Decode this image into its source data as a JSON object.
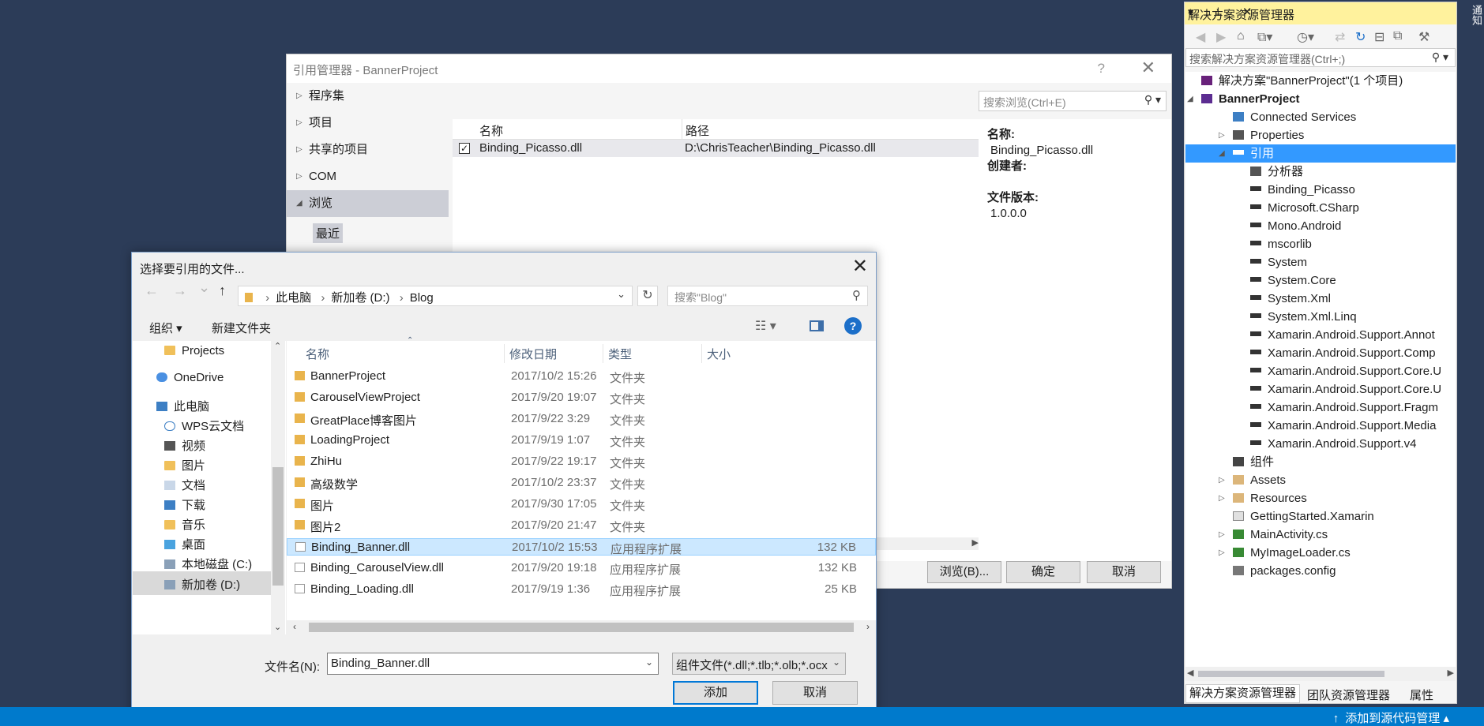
{
  "ref_manager": {
    "title": "引用管理器 - BannerProject",
    "help": "?",
    "close": "✕",
    "nav": [
      {
        "label": "程序集",
        "arrow": "▷"
      },
      {
        "label": "项目",
        "arrow": "▷"
      },
      {
        "label": "共享的项目",
        "arrow": "▷"
      },
      {
        "label": "COM",
        "arrow": "▷"
      },
      {
        "label": "浏览",
        "arrow": "◢"
      }
    ],
    "nav_sub": "最近",
    "search_placeholder": "搜索浏览(Ctrl+E)",
    "columns": {
      "name": "名称",
      "path": "路径"
    },
    "rows": [
      {
        "checked": "✓",
        "name": "Binding_Picasso.dll",
        "path": "D:\\ChrisTeacher\\Binding_Picasso.dll"
      }
    ],
    "details": {
      "name_label": "名称:",
      "name_value": "Binding_Picasso.dll",
      "creator_label": "创建者:",
      "version_label": "文件版本:",
      "version_value": "1.0.0.0"
    },
    "buttons": {
      "browse": "浏览(B)...",
      "ok": "确定",
      "cancel": "取消"
    }
  },
  "file_dialog": {
    "title": "选择要引用的文件...",
    "close": "✕",
    "nav": {
      "back": "←",
      "forward": "→",
      "down": "⌄",
      "up": "↑"
    },
    "breadcrumb": [
      "此电脑",
      "新加卷 (D:)",
      "Blog"
    ],
    "search_placeholder": "搜索\"Blog\"",
    "toolbar": {
      "organize": "组织 ▾",
      "new_folder": "新建文件夹"
    },
    "tree": [
      {
        "label": "Projects",
        "icon": "folder-icon"
      },
      {
        "label": "OneDrive",
        "icon": "cloud-icon"
      },
      {
        "label": "此电脑",
        "icon": "pc-icon"
      },
      {
        "label": "WPS云文档",
        "icon": "cloud-icon"
      },
      {
        "label": "视频",
        "icon": "video-icon"
      },
      {
        "label": "图片",
        "icon": "pictures-icon"
      },
      {
        "label": "文档",
        "icon": "documents-icon"
      },
      {
        "label": "下载",
        "icon": "download-icon"
      },
      {
        "label": "音乐",
        "icon": "music-icon"
      },
      {
        "label": "桌面",
        "icon": "desktop-icon"
      },
      {
        "label": "本地磁盘 (C:)",
        "icon": "drive-icon"
      },
      {
        "label": "新加卷 (D:)",
        "icon": "drive-icon"
      }
    ],
    "columns": {
      "name": "名称",
      "date": "修改日期",
      "type": "类型",
      "size": "大小"
    },
    "files": [
      {
        "name": "BannerProject",
        "date": "2017/10/2 15:26",
        "type": "文件夹",
        "size": "",
        "kind": "folder"
      },
      {
        "name": "CarouselViewProject",
        "date": "2017/9/20 19:07",
        "type": "文件夹",
        "size": "",
        "kind": "folder"
      },
      {
        "name": "GreatPlace博客图片",
        "date": "2017/9/22 3:29",
        "type": "文件夹",
        "size": "",
        "kind": "folder"
      },
      {
        "name": "LoadingProject",
        "date": "2017/9/19 1:07",
        "type": "文件夹",
        "size": "",
        "kind": "folder"
      },
      {
        "name": "ZhiHu",
        "date": "2017/9/22 19:17",
        "type": "文件夹",
        "size": "",
        "kind": "folder"
      },
      {
        "name": "高级数学",
        "date": "2017/10/2 23:37",
        "type": "文件夹",
        "size": "",
        "kind": "folder"
      },
      {
        "name": "图片",
        "date": "2017/9/30 17:05",
        "type": "文件夹",
        "size": "",
        "kind": "folder"
      },
      {
        "name": "图片2",
        "date": "2017/9/20 21:47",
        "type": "文件夹",
        "size": "",
        "kind": "folder"
      },
      {
        "name": "Binding_Banner.dll",
        "date": "2017/10/2 15:53",
        "type": "应用程序扩展",
        "size": "132 KB",
        "kind": "dll",
        "selected": true
      },
      {
        "name": "Binding_CarouselView.dll",
        "date": "2017/9/20 19:18",
        "type": "应用程序扩展",
        "size": "132 KB",
        "kind": "dll"
      },
      {
        "name": "Binding_Loading.dll",
        "date": "2017/9/19 1:36",
        "type": "应用程序扩展",
        "size": "25 KB",
        "kind": "dll"
      }
    ],
    "filename_label": "文件名(N):",
    "filename_value": "Binding_Banner.dll",
    "filetype_value": "组件文件(*.dll;*.tlb;*.olb;*.ocx",
    "buttons": {
      "add": "添加",
      "cancel": "取消"
    }
  },
  "solution_explorer": {
    "title": "解决方案资源管理器",
    "title_buttons": "▾ ⊥ ✕",
    "search_placeholder": "搜索解决方案资源管理器(Ctrl+;)",
    "tree": [
      {
        "label": "解决方案\"BannerProject\"(1 个项目)",
        "level": 0,
        "arrow": "",
        "icon": "solution-icon"
      },
      {
        "label": "BannerProject",
        "level": 0,
        "arrow": "◢",
        "icon": "project-icon",
        "bold": true
      },
      {
        "label": "Connected Services",
        "level": 1,
        "arrow": "",
        "icon": "cloud-icon"
      },
      {
        "label": "Properties",
        "level": 1,
        "arrow": "▷",
        "icon": "wrench-icon"
      },
      {
        "label": "引用",
        "level": 1,
        "arrow": "◢",
        "icon": "reference-icon",
        "selected": true
      },
      {
        "label": "分析器",
        "level": 2,
        "arrow": "",
        "icon": "analyzer-icon"
      },
      {
        "label": "Binding_Picasso",
        "level": 2,
        "arrow": "",
        "icon": "reference-icon"
      },
      {
        "label": "Microsoft.CSharp",
        "level": 2,
        "arrow": "",
        "icon": "reference-icon"
      },
      {
        "label": "Mono.Android",
        "level": 2,
        "arrow": "",
        "icon": "reference-icon"
      },
      {
        "label": "mscorlib",
        "level": 2,
        "arrow": "",
        "icon": "reference-icon"
      },
      {
        "label": "System",
        "level": 2,
        "arrow": "",
        "icon": "reference-icon"
      },
      {
        "label": "System.Core",
        "level": 2,
        "arrow": "",
        "icon": "reference-icon"
      },
      {
        "label": "System.Xml",
        "level": 2,
        "arrow": "",
        "icon": "reference-icon"
      },
      {
        "label": "System.Xml.Linq",
        "level": 2,
        "arrow": "",
        "icon": "reference-icon"
      },
      {
        "label": "Xamarin.Android.Support.Annot",
        "level": 2,
        "arrow": "",
        "icon": "reference-icon"
      },
      {
        "label": "Xamarin.Android.Support.Comp",
        "level": 2,
        "arrow": "",
        "icon": "reference-icon"
      },
      {
        "label": "Xamarin.Android.Support.Core.U",
        "level": 2,
        "arrow": "",
        "icon": "reference-icon"
      },
      {
        "label": "Xamarin.Android.Support.Core.U",
        "level": 2,
        "arrow": "",
        "icon": "reference-icon"
      },
      {
        "label": "Xamarin.Android.Support.Fragm",
        "level": 2,
        "arrow": "",
        "icon": "reference-icon"
      },
      {
        "label": "Xamarin.Android.Support.Media",
        "level": 2,
        "arrow": "",
        "icon": "reference-icon"
      },
      {
        "label": "Xamarin.Android.Support.v4",
        "level": 2,
        "arrow": "",
        "icon": "reference-icon"
      },
      {
        "label": "组件",
        "level": 1,
        "arrow": "",
        "icon": "component-icon"
      },
      {
        "label": "Assets",
        "level": 1,
        "arrow": "▷",
        "icon": "folder-icon"
      },
      {
        "label": "Resources",
        "level": 1,
        "arrow": "▷",
        "icon": "folder-icon"
      },
      {
        "label": "GettingStarted.Xamarin",
        "level": 1,
        "arrow": "",
        "icon": "file-icon"
      },
      {
        "label": "MainActivity.cs",
        "level": 1,
        "arrow": "▷",
        "icon": "csharp-icon"
      },
      {
        "label": "MyImageLoader.cs",
        "level": 1,
        "arrow": "▷",
        "icon": "csharp-icon"
      },
      {
        "label": "packages.config",
        "level": 1,
        "arrow": "",
        "icon": "config-icon"
      }
    ],
    "tabs": [
      "解决方案资源管理器",
      "团队资源管理器",
      "属性"
    ]
  },
  "notifications": "通知",
  "statusbar": {
    "source_control": "添加到源代码管理 ▴"
  },
  "colors": {
    "accent": "#007acc",
    "background": "#2c3c58",
    "selection": "#3399ff",
    "title_highlight": "#fff29d"
  }
}
